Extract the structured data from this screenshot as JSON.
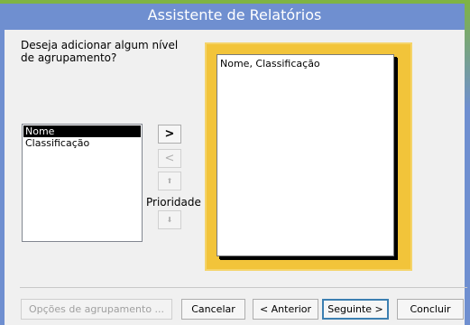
{
  "window": {
    "title": "Assistente de Relatórios"
  },
  "question": "Deseja adicionar algum nível de agrupamento?",
  "fields": [
    {
      "label": "Nome",
      "selected": true
    },
    {
      "label": "Classificação",
      "selected": false
    }
  ],
  "arrows": {
    "add": ">",
    "remove": "<",
    "priority_up": "⬆",
    "priority_down": "⬇"
  },
  "priority_label": "Prioridade",
  "preview": {
    "text": "Nome, Classificação"
  },
  "buttons": {
    "grouping_options": "Opções de agrupamento ...",
    "cancel": "Cancelar",
    "back": "< Anterior",
    "next": "Seguinte >",
    "finish": "Concluir"
  },
  "colors": {
    "titlebar": "#6f8fd0",
    "accent_green": "#7fb443",
    "preview_frame": "#f2c43a"
  }
}
